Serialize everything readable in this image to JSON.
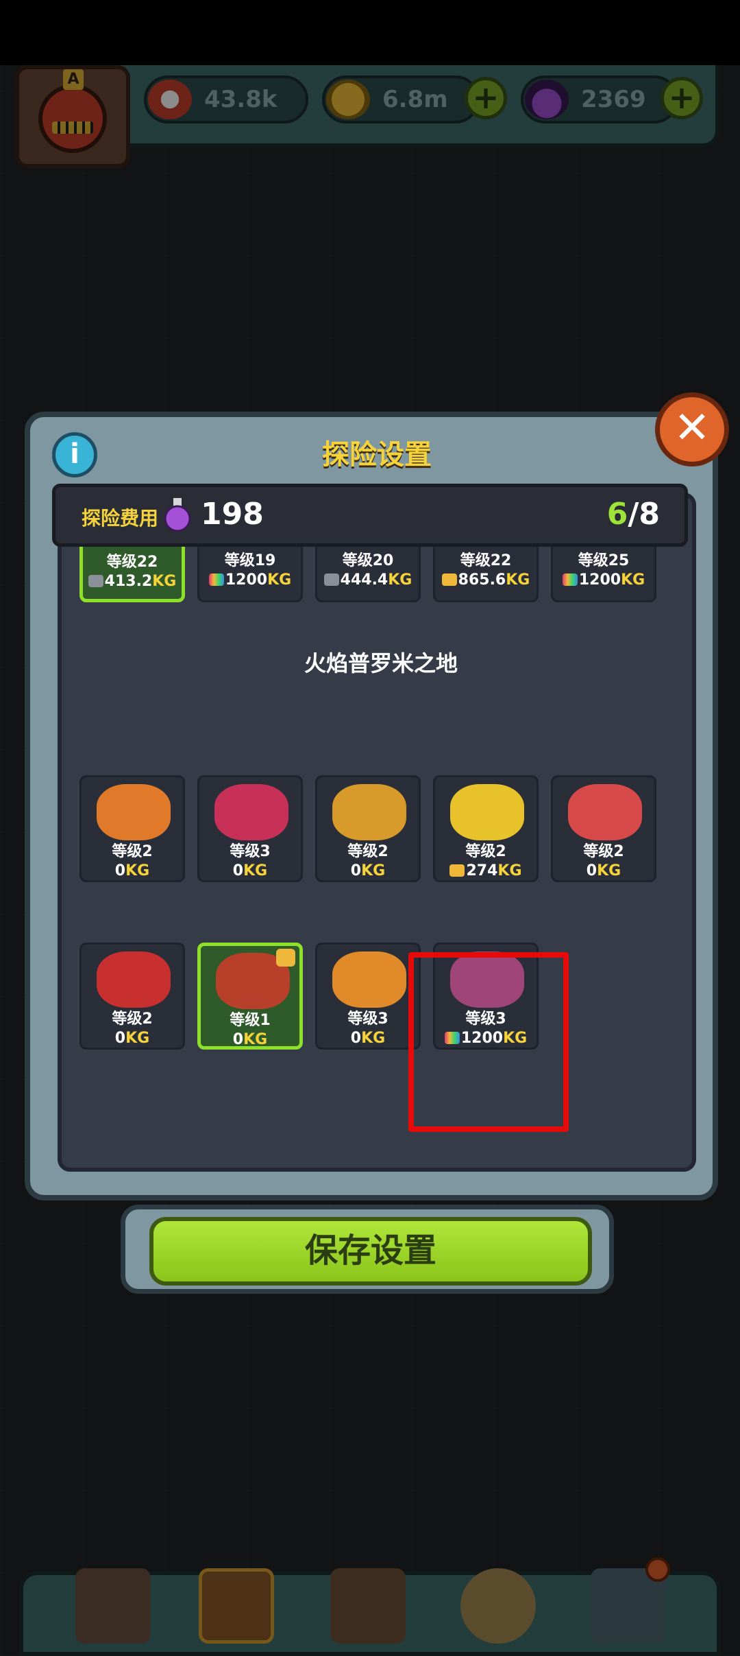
{
  "resources": {
    "eyes": "43.8k",
    "coins": "6.8m",
    "potions": "2369"
  },
  "dialog": {
    "title": "探险设置",
    "close_label": "✕",
    "info_label": "i",
    "cost_label": "探险费用",
    "cost_value": "198",
    "selected_count": "6",
    "max_count": "/8",
    "section_title": "火焰普罗米之地",
    "save_label": "保存设置"
  },
  "top_row": [
    {
      "level": "等级22",
      "weight_value": "413.2",
      "unit": "KG",
      "icon": "kg-gray",
      "selected": true
    },
    {
      "level": "等级19",
      "weight_value": "1200",
      "unit": "KG",
      "icon": "kg-rainbow",
      "selected": false
    },
    {
      "level": "等级20",
      "weight_value": "444.4",
      "unit": "KG",
      "icon": "kg-gray",
      "selected": false
    },
    {
      "level": "等级22",
      "weight_value": "865.6",
      "unit": "KG",
      "icon": "kg-gold",
      "selected": false
    },
    {
      "level": "等级25",
      "weight_value": "1200",
      "unit": "KG",
      "icon": "kg-rainbow",
      "selected": false
    }
  ],
  "fire_row_1": [
    {
      "level": "等级2",
      "weight_value": "0",
      "unit": "KG"
    },
    {
      "level": "等级3",
      "weight_value": "0",
      "unit": "KG"
    },
    {
      "level": "等级2",
      "weight_value": "0",
      "unit": "KG"
    },
    {
      "level": "等级2",
      "weight_value": "274",
      "unit": "KG",
      "icon": "kg-gold"
    },
    {
      "level": "等级2",
      "weight_value": "0",
      "unit": "KG"
    }
  ],
  "fire_row_2": [
    {
      "level": "等级2",
      "weight_value": "0",
      "unit": "KG"
    },
    {
      "level": "等级1",
      "weight_value": "0",
      "unit": "KG",
      "selected": true
    },
    {
      "level": "等级3",
      "weight_value": "0",
      "unit": "KG"
    },
    {
      "level": "等级3",
      "weight_value": "1200",
      "unit": "KG",
      "icon": "kg-rainbow"
    }
  ],
  "colors": {
    "accent_yellow": "#f6d33a",
    "selected_green": "#8ee02a",
    "highlight_red": "#e50b0b"
  },
  "icons": [
    "eye-icon",
    "coin-icon",
    "potion-icon",
    "plus-icon",
    "info-icon",
    "close-icon",
    "kg-weight-icon",
    "shop-icon",
    "monster-icon",
    "book-icon",
    "bag-icon",
    "grid-icon"
  ]
}
